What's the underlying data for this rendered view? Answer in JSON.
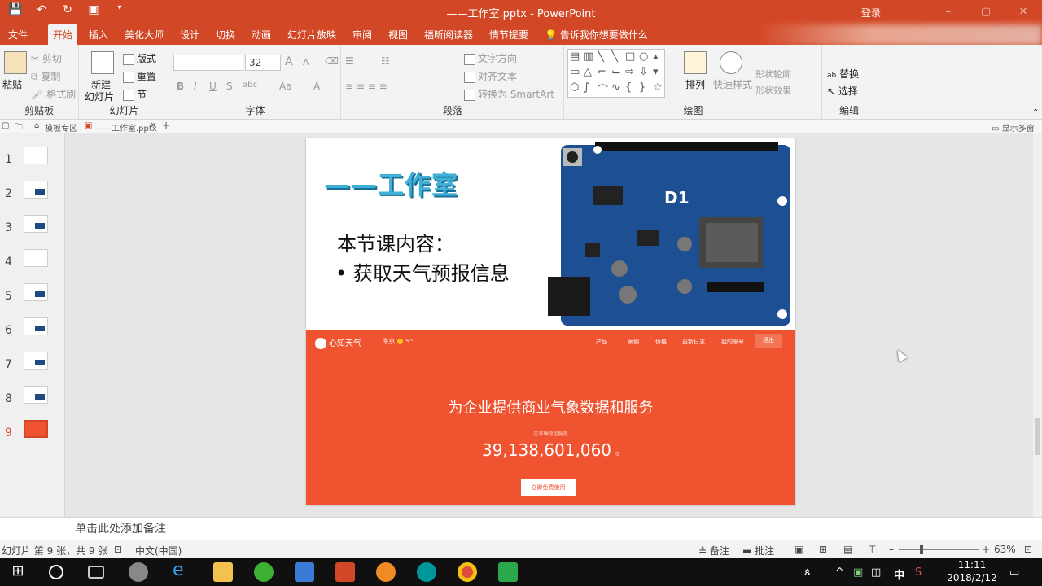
{
  "window": {
    "title": "——工作室.pptx - PowerPoint",
    "login": "登录",
    "controls": [
      "–",
      "▢",
      "✕"
    ]
  },
  "tabs": [
    "文件",
    "开始",
    "插入",
    "美化大师",
    "设计",
    "切换",
    "动画",
    "幻灯片放映",
    "审阅",
    "视图",
    "福昕阅读器",
    "情节提要"
  ],
  "tell_me": "告诉我你想要做什么",
  "ribbon": {
    "clipboard": {
      "label": "剪贴板",
      "paste": "粘贴",
      "cut": "剪切",
      "copy": "复制",
      "format_painter": "格式刷"
    },
    "slides": {
      "label": "幻灯片",
      "new_slide_line1": "新建",
      "new_slide_line2": "幻灯片",
      "layout": "版式",
      "reset": "重置",
      "section": "节"
    },
    "font": {
      "label": "字体",
      "name": "",
      "size": "32",
      "bold": "B",
      "italic": "I",
      "underline": "U",
      "shadow": "S",
      "spacing": "abc",
      "case": "Aa",
      "grow": "A",
      "shrink": "A"
    },
    "paragraph": {
      "label": "段落",
      "text_direction": "文字方向",
      "align_text": "对齐文本",
      "smartart": "转换为 SmartArt"
    },
    "drawing": {
      "label": "绘图",
      "arrange": "排列",
      "quick_styles": "快速样式",
      "shape_outline": "形状轮廓",
      "shape_effects": "形状效果"
    },
    "editing": {
      "label": "编辑",
      "replace": "替换",
      "select": "选择"
    }
  },
  "doc_tabs": {
    "templates": "模板专区",
    "current": "——工作室.pptx",
    "show_multi": "显示多窗口"
  },
  "slides": [
    {
      "num": "1"
    },
    {
      "num": "2"
    },
    {
      "num": "3"
    },
    {
      "num": "4"
    },
    {
      "num": "5"
    },
    {
      "num": "6"
    },
    {
      "num": "7"
    },
    {
      "num": "8"
    },
    {
      "num": "9",
      "active": true
    }
  ],
  "slide": {
    "title": "——工作室",
    "heading": "本节课内容：",
    "bullet": "• 获取天气预报信息",
    "board_label": "D1",
    "weather_site": {
      "logo": "心知天气",
      "city": "南京",
      "temp": "5°",
      "nav": [
        "产品",
        "案例",
        "价格",
        "更新日志",
        "我的账号"
      ],
      "nav_button": "退出",
      "headline": "为企业提供商业气象数据和服务",
      "subline": "已准确稳定服务",
      "count": "39,138,601,060",
      "count_unit": "次",
      "cta": "立即免费使用"
    }
  },
  "notes_placeholder": "单击此处添加备注",
  "status": {
    "slide_info": "幻灯片 第 9 张，共 9 张",
    "language": "中文(中国)",
    "notes": "备注",
    "comments": "批注",
    "zoom": "63%"
  },
  "taskbar": {
    "time": "11:11",
    "date": "2018/2/12",
    "ime": "中"
  },
  "colors": {
    "accent": "#d24726",
    "weather_red": "#ef5330"
  }
}
